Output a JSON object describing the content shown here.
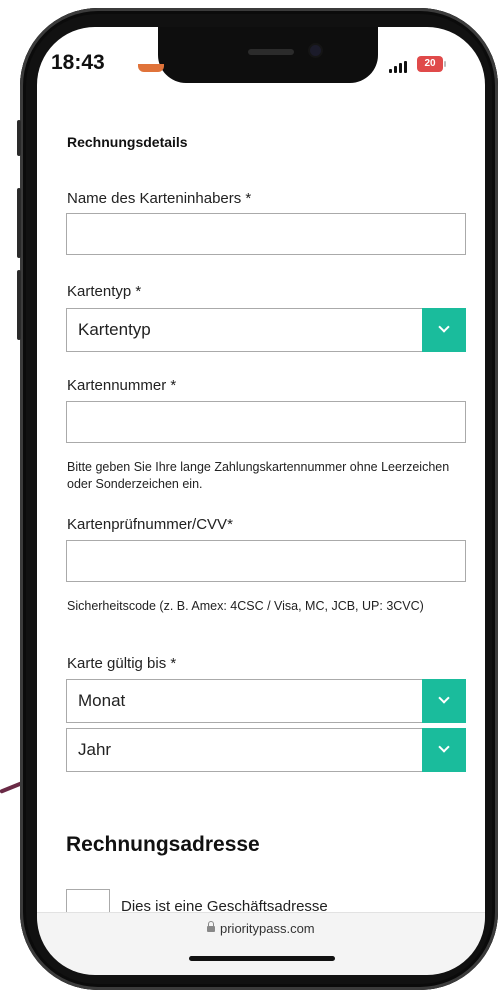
{
  "status_bar": {
    "time": "18:43",
    "battery": "20"
  },
  "form": {
    "section_title": "Rechnungsdetails",
    "cardholder_label": "Name des Karteninhabers *",
    "cardholder_value": "",
    "card_type_label": "Kartentyp *",
    "card_type_value": "Kartentyp",
    "card_number_label": "Kartennummer *",
    "card_number_value": "",
    "card_number_hint": "Bitte geben Sie Ihre lange Zahlungskartennummer ohne Leerzeichen oder Sonderzeichen ein.",
    "cvv_label": "Kartenprüfnummer/CVV*",
    "cvv_value": "",
    "cvv_hint": "Sicherheitscode (z. B. Amex: 4CSC / Visa, MC, JCB, UP: 3CVC)",
    "expiry_label": "Karte gültig bis *",
    "month_value": "Monat",
    "year_value": "Jahr"
  },
  "billing_address": {
    "title": "Rechnungsadresse",
    "business_checkbox_label": "Dies ist eine Geschäftsadresse",
    "business_checked": false
  },
  "browser": {
    "url": "prioritypass.com"
  },
  "colors": {
    "accent": "#1abc9c",
    "battery": "#e04a4a"
  },
  "icons": [
    "chevron-down-icon",
    "lock-icon",
    "signal-icon",
    "battery-icon"
  ]
}
